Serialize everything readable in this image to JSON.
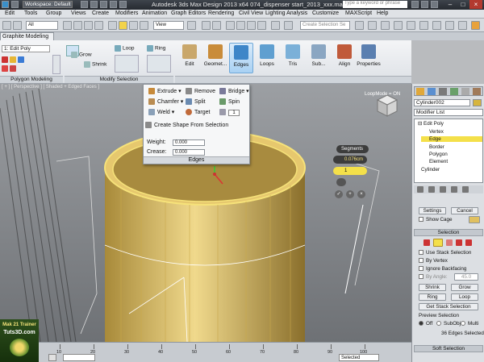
{
  "titlebar": {
    "workspace": "Workspace: Default",
    "title": "Autodesk 3ds Max Design 2013 x64      074_dispenser start_2013_xxx.max",
    "search_placeholder": "Type a keyword or phrase"
  },
  "menu": [
    "Edit",
    "Tools",
    "Group",
    "Views",
    "Create",
    "Modifiers",
    "Animation",
    "Graph Editors",
    "Rendering",
    "Civil View",
    "Lighting Analysis",
    "Customize",
    "MAXScript",
    "Help"
  ],
  "toolbar": {
    "filter": "All",
    "view_select": "View",
    "selection_set_placeholder": "Create Selection Se"
  },
  "ribbon": {
    "tab": "Graphite Modeling",
    "edit_poly": "1: Edit Poly",
    "grow": "Grow",
    "shrink": "Shrink",
    "loop": "Loop",
    "ring": "Ring",
    "buttons": [
      "Edit",
      "Geomet...",
      "Edges",
      "Loops",
      "Tris",
      "Sub...",
      "Align",
      "Properties"
    ],
    "polygon_modeling": "Polygon Modeling",
    "modify_selection": "Modify Selection"
  },
  "viewport": {
    "label": "[ + ] [ Perspective ] [ Shaded + Edged Faces ]",
    "loopmode": "LoopMode = ON"
  },
  "edges_popup": {
    "extrude": "Extrude",
    "remove": "Remove",
    "bridge": "Bridge",
    "chamfer": "Chamfer",
    "split": "Split",
    "spin": "Spin",
    "weld": "Weld",
    "target": "Target",
    "target_value": "1",
    "create_shape": "Create Shape From Selection",
    "weight_label": "Weight:",
    "weight_value": "0.000",
    "crease_label": "Crease:",
    "crease_value": "0.000",
    "footer": "Edges"
  },
  "caddy": {
    "title": "Segments",
    "value1": "0.076cm",
    "value2": "1"
  },
  "command_panel": {
    "object_name": "Cylinder002",
    "modifier_list": "Modifier List",
    "stack": [
      "Edit Poly",
      "Vertex",
      "Edge",
      "Border",
      "Polygon",
      "Element",
      "Cylinder"
    ],
    "selected_level": "Edge",
    "settings": "Settings",
    "cancel": "Cancel",
    "show_cage": "Show Cage",
    "selection_rollout": "Selection",
    "use_stack_selection": "Use Stack Selection",
    "by_vertex": "By Vertex",
    "ignore_backfacing": "Ignore Backfacing",
    "by_angle": "By Angle:",
    "by_angle_value": "45.0",
    "shrink": "Shrink",
    "grow": "Grow",
    "ring": "Ring",
    "loop": "Loop",
    "get_stack_selection": "Get Stack Selection",
    "preview_selection": "Preview Selection",
    "preview_off": "Off",
    "preview_subobj": "SubObj",
    "preview_multi": "Multi",
    "edges_selected": "36 Edges Selected",
    "soft_selection": "Soft Selection"
  },
  "timeline": {
    "ticks": [
      "10",
      "20",
      "30",
      "40",
      "50",
      "60",
      "70",
      "80",
      "90",
      "100"
    ],
    "selected": "Selected"
  },
  "watermark": {
    "line1": "Mak 21 Trainer",
    "line2": "Tuts3D.com"
  },
  "colors": {
    "mesh": "#e6c86e",
    "accent": "#6fa8d8",
    "selected_row": "#f4e04a"
  }
}
